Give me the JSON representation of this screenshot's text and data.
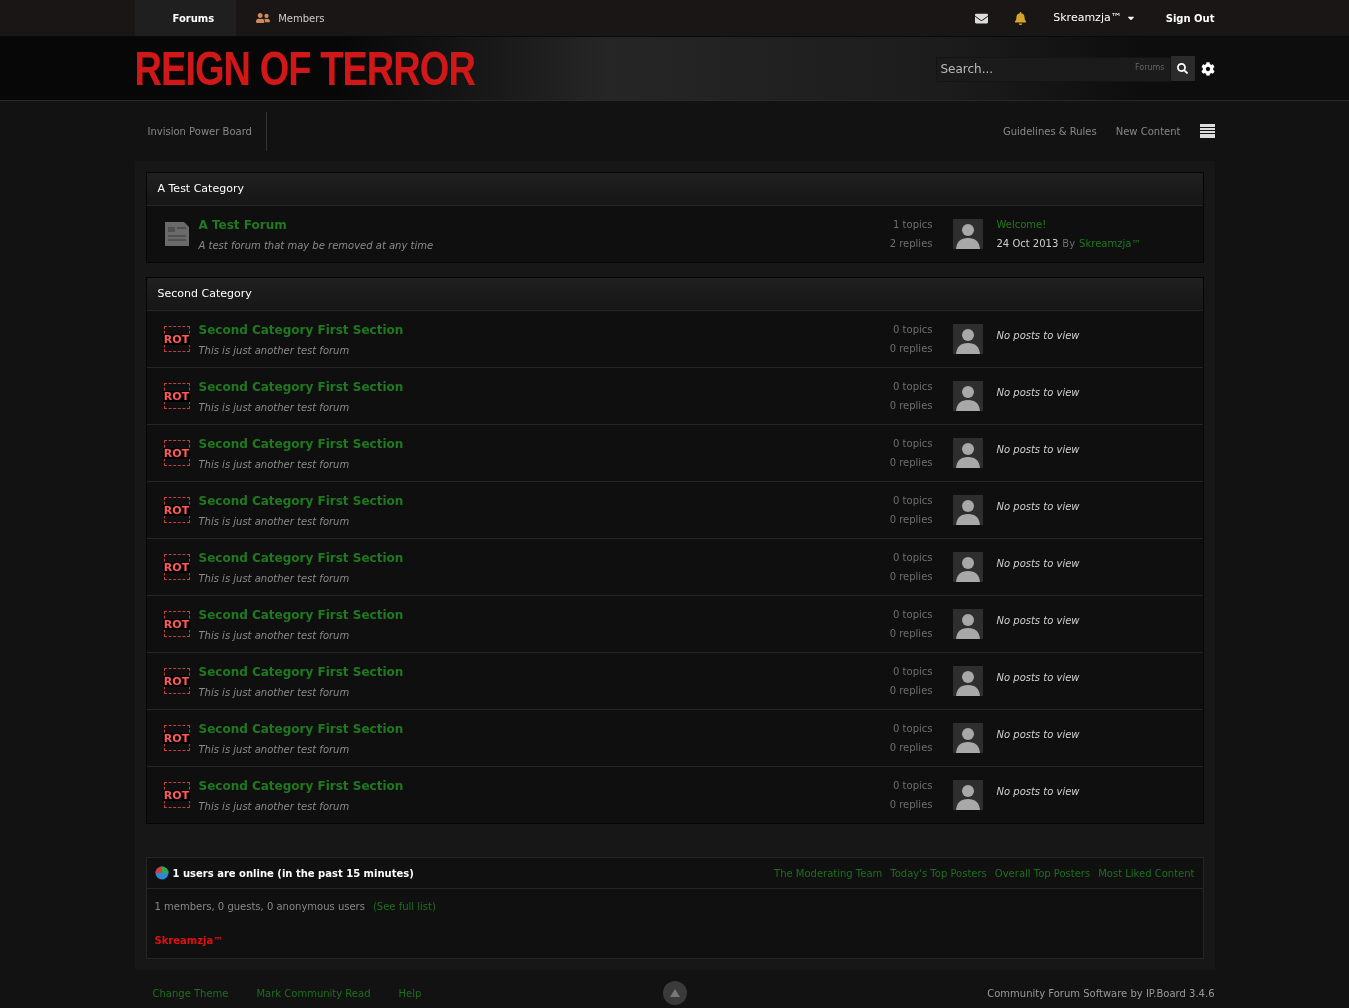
{
  "top_nav": {
    "tabs": [
      {
        "label": "Forums",
        "selected": true,
        "icon": false
      },
      {
        "label": "Members",
        "selected": false,
        "icon": true
      }
    ],
    "user": "Skreamzja™",
    "sign_out": "Sign Out"
  },
  "header": {
    "logo": "REIGN OF TERROR",
    "search": {
      "placeholder": "Search...",
      "scope": "Forums"
    }
  },
  "breadcrumb": [
    "Invision Power Board"
  ],
  "quick_links": [
    "Guidelines & Rules",
    "New Content"
  ],
  "categories": [
    {
      "title": "A Test Category",
      "forums": [
        {
          "kind": "newspaper",
          "name": "A Test Forum",
          "description": "A test forum that may be removed at any time",
          "topics": "1 topics",
          "replies": "2 replies",
          "last_post": {
            "title": "Welcome!",
            "date": "24 Oct 2013",
            "by": "By",
            "author": "Skreamzja™"
          }
        }
      ]
    },
    {
      "title": "Second Category",
      "forums": [
        {
          "kind": "badge",
          "badge": "ROT",
          "name": "Second Category First Section",
          "description": "This is just another test forum",
          "topics": "0 topics",
          "replies": "0 replies",
          "no_posts": "No posts to view"
        },
        {
          "kind": "badge",
          "badge": "ROT",
          "name": "Second Category First Section",
          "description": "This is just another test forum",
          "topics": "0 topics",
          "replies": "0 replies",
          "no_posts": "No posts to view"
        },
        {
          "kind": "badge",
          "badge": "ROT",
          "name": "Second Category First Section",
          "description": "This is just another test forum",
          "topics": "0 topics",
          "replies": "0 replies",
          "no_posts": "No posts to view"
        },
        {
          "kind": "badge",
          "badge": "ROT",
          "name": "Second Category First Section",
          "description": "This is just another test forum",
          "topics": "0 topics",
          "replies": "0 replies",
          "no_posts": "No posts to view"
        },
        {
          "kind": "badge",
          "badge": "ROT",
          "name": "Second Category First Section",
          "description": "This is just another test forum",
          "topics": "0 topics",
          "replies": "0 replies",
          "no_posts": "No posts to view"
        },
        {
          "kind": "badge",
          "badge": "ROT",
          "name": "Second Category First Section",
          "description": "This is just another test forum",
          "topics": "0 topics",
          "replies": "0 replies",
          "no_posts": "No posts to view"
        },
        {
          "kind": "badge",
          "badge": "ROT",
          "name": "Second Category First Section",
          "description": "This is just another test forum",
          "topics": "0 topics",
          "replies": "0 replies",
          "no_posts": "No posts to view"
        },
        {
          "kind": "badge",
          "badge": "ROT",
          "name": "Second Category First Section",
          "description": "This is just another test forum",
          "topics": "0 topics",
          "replies": "0 replies",
          "no_posts": "No posts to view"
        },
        {
          "kind": "badge",
          "badge": "ROT",
          "name": "Second Category First Section",
          "description": "This is just another test forum",
          "topics": "0 topics",
          "replies": "0 replies",
          "no_posts": "No posts to view"
        }
      ]
    }
  ],
  "online": {
    "title": "1 users are online (in the past 15 minutes)",
    "links": [
      "The Moderating Team",
      "Today's Top Posters",
      "Overall Top Posters",
      "Most Liked Content"
    ],
    "summary": "1 members, 0 guests, 0 anonymous users",
    "see_full": "(See full list)",
    "users": [
      "Skreamzja™"
    ]
  },
  "footer": {
    "links": [
      "Change Theme",
      "Mark Community Read",
      "Help"
    ],
    "credit": "Community Forum Software by IP.Board 3.4.6"
  }
}
